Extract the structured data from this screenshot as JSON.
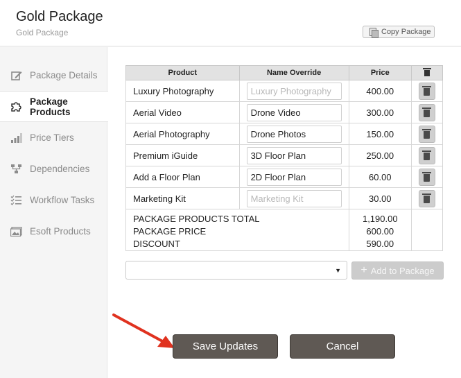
{
  "header": {
    "title": "Gold Package",
    "subtitle": "Gold Package",
    "copy_label": "Copy Package"
  },
  "sidebar": {
    "items": [
      {
        "label": "Package Details",
        "icon": "edit-icon"
      },
      {
        "label": "Package Products",
        "icon": "puzzle-icon",
        "active": true
      },
      {
        "label": "Price Tiers",
        "icon": "signal-bars-icon"
      },
      {
        "label": "Dependencies",
        "icon": "sitemap-icon"
      },
      {
        "label": "Workflow Tasks",
        "icon": "tasks-icon"
      },
      {
        "label": "Esoft Products",
        "icon": "image-icon"
      }
    ]
  },
  "table": {
    "headers": {
      "product": "Product",
      "override": "Name Override",
      "price": "Price"
    },
    "rows": [
      {
        "product": "Luxury Photography",
        "override": "",
        "placeholder": "Luxury Photography",
        "price": "400.00"
      },
      {
        "product": "Aerial Video",
        "override": "Drone Video",
        "placeholder": "Aerial Video",
        "price": "300.00"
      },
      {
        "product": "Aerial Photography",
        "override": "Drone Photos",
        "placeholder": "Aerial Photography",
        "price": "150.00"
      },
      {
        "product": "Premium iGuide",
        "override": "3D Floor Plan",
        "placeholder": "Premium iGuide",
        "price": "250.00"
      },
      {
        "product": "Add a Floor Plan",
        "override": "2D Floor Plan",
        "placeholder": "Add a Floor Plan",
        "price": "60.00"
      },
      {
        "product": "Marketing Kit",
        "override": "",
        "placeholder": "Marketing Kit",
        "price": "30.00"
      }
    ],
    "summary": {
      "total_label": "PACKAGE PRODUCTS TOTAL",
      "total_value": "1,190.00",
      "price_label": "PACKAGE PRICE",
      "price_value": "600.00",
      "discount_label": "DISCOUNT",
      "discount_value": "590.00"
    }
  },
  "add_product": {
    "selected": "",
    "button_label": "Add to Package"
  },
  "actions": {
    "save_label": "Save Updates",
    "cancel_label": "Cancel"
  },
  "colors": {
    "button_dark": "#5f5954",
    "annotation_arrow": "#e0321f",
    "sidebar_bg": "#f5f5f5"
  }
}
